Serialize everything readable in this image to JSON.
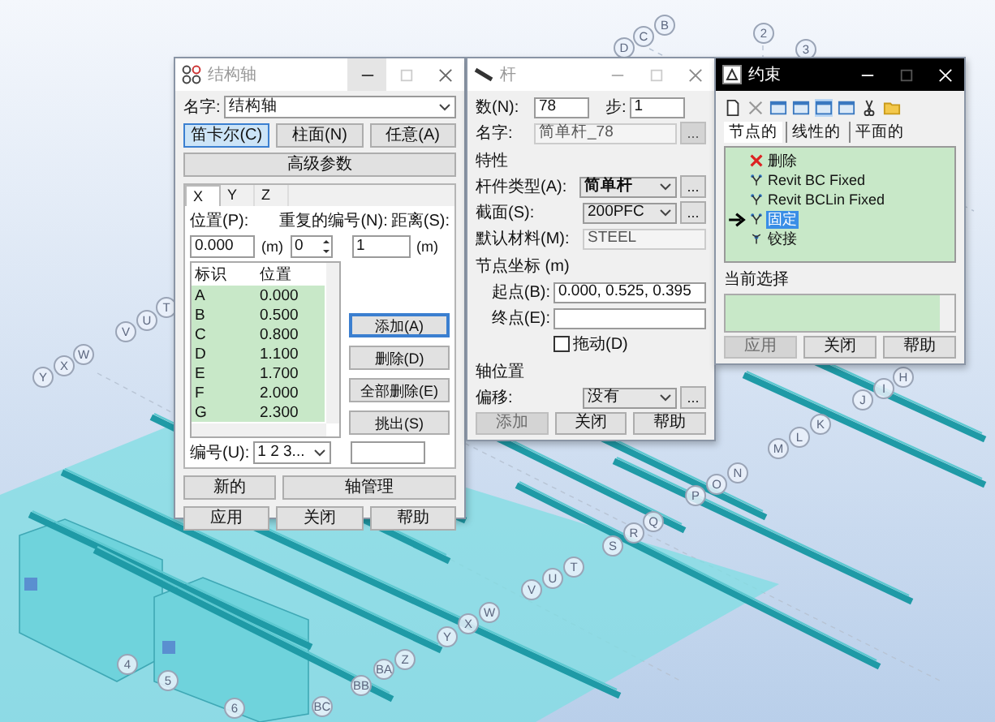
{
  "viewport": {
    "axis_labels": [
      "D",
      "C",
      "B",
      "2",
      "3",
      "T",
      "U",
      "V",
      "W",
      "X",
      "Y",
      "H",
      "I",
      "J",
      "K",
      "L",
      "M",
      "N",
      "O",
      "P",
      "Q",
      "R",
      "S",
      "T",
      "U",
      "V",
      "W",
      "X",
      "Y",
      "Z",
      "BA",
      "BB",
      "BC",
      "6",
      "5",
      "4"
    ]
  },
  "axis_dialog": {
    "title": "结构轴",
    "active": false,
    "name_label": "名字:",
    "name_value": "结构轴",
    "modes": [
      {
        "label": "笛卡尔(C)",
        "selected": true
      },
      {
        "label": "柱面(N)",
        "selected": false
      },
      {
        "label": "任意(A)",
        "selected": false
      }
    ],
    "advanced_button": "高级参数",
    "tabs": [
      {
        "label": "X",
        "selected": true
      },
      {
        "label": "Y",
        "selected": false
      },
      {
        "label": "Z",
        "selected": false
      }
    ],
    "position": {
      "label": "位置(P):",
      "value": "0.000",
      "unit": "(m)"
    },
    "repeat": {
      "label": "重复的编号(N):",
      "value": "0"
    },
    "distance": {
      "label": "距离(S):",
      "value": "1",
      "unit": "(m)"
    },
    "table": {
      "columns": [
        "标识",
        "位置"
      ],
      "rows": [
        {
          "cells": [
            "A",
            "0.000"
          ]
        },
        {
          "cells": [
            "B",
            "0.500"
          ]
        },
        {
          "cells": [
            "C",
            "0.800"
          ]
        },
        {
          "cells": [
            "D",
            "1.100"
          ]
        },
        {
          "cells": [
            "E",
            "1.700"
          ]
        },
        {
          "cells": [
            "F",
            "2.000"
          ]
        },
        {
          "cells": [
            "G",
            "2.300"
          ]
        }
      ]
    },
    "side_buttons": [
      {
        "label": "添加(A)",
        "focused": true
      },
      {
        "label": "删除(D)",
        "focused": false
      },
      {
        "label": "全部删除(E)",
        "focused": false
      },
      {
        "label": "挑出(S)",
        "focused": false
      }
    ],
    "numbering": {
      "label": "编号(U):",
      "value": "1 2 3..."
    },
    "footer_rows": [
      {
        "buttons": [
          "新的",
          "轴管理"
        ]
      },
      {
        "buttons": [
          "应用",
          "关闭",
          "帮助"
        ]
      }
    ]
  },
  "rod_dialog": {
    "title": "杆",
    "active": false,
    "count": {
      "label": "数(N):",
      "value": "78"
    },
    "step": {
      "label": "步:",
      "value": "1"
    },
    "name": {
      "label": "名字:",
      "value": "简单杆_78",
      "disabled": true,
      "more": "..."
    },
    "properties_heading": "特性",
    "member_type": {
      "label": "杆件类型(A):",
      "value": "简单杆",
      "more": "..."
    },
    "section": {
      "label": "截面(S):",
      "value": "200PFC",
      "more": "..."
    },
    "material": {
      "label": "默认材料(M):",
      "value": "STEEL",
      "disabled": true
    },
    "nodes_heading": "节点坐标 (m)",
    "start": {
      "label": "起点(B):",
      "value": "0.000, 0.525, 0.395"
    },
    "end": {
      "label": "终点(E):"
    },
    "drag": {
      "label": "拖动(D)",
      "checked": false
    },
    "axis_heading": "轴位置",
    "offset": {
      "label": "偏移:",
      "value": "没有",
      "more": "..."
    },
    "buttons": [
      {
        "label": "添加",
        "disabled": true
      },
      {
        "label": "关闭",
        "disabled": false
      },
      {
        "label": "帮助",
        "disabled": false
      }
    ]
  },
  "constraints_dialog": {
    "title": "约束",
    "active": true,
    "tabs": [
      {
        "label": "节点的",
        "selected": true
      },
      {
        "label": "线性的",
        "selected": false
      },
      {
        "label": "平面的",
        "selected": false
      }
    ],
    "items": [
      {
        "kind": "delete",
        "label": "删除",
        "selected": false
      },
      {
        "kind": "support",
        "label": "Revit BC Fixed",
        "selected": false
      },
      {
        "kind": "support",
        "label": "Revit BCLin Fixed",
        "selected": false
      },
      {
        "kind": "support",
        "label": "固定",
        "selected": true
      },
      {
        "kind": "hinge",
        "label": "铰接",
        "selected": false
      }
    ],
    "current_label": "当前选择",
    "buttons": [
      {
        "label": "应用",
        "disabled": true
      },
      {
        "label": "关闭",
        "disabled": false
      },
      {
        "label": "帮助",
        "disabled": false
      }
    ]
  }
}
